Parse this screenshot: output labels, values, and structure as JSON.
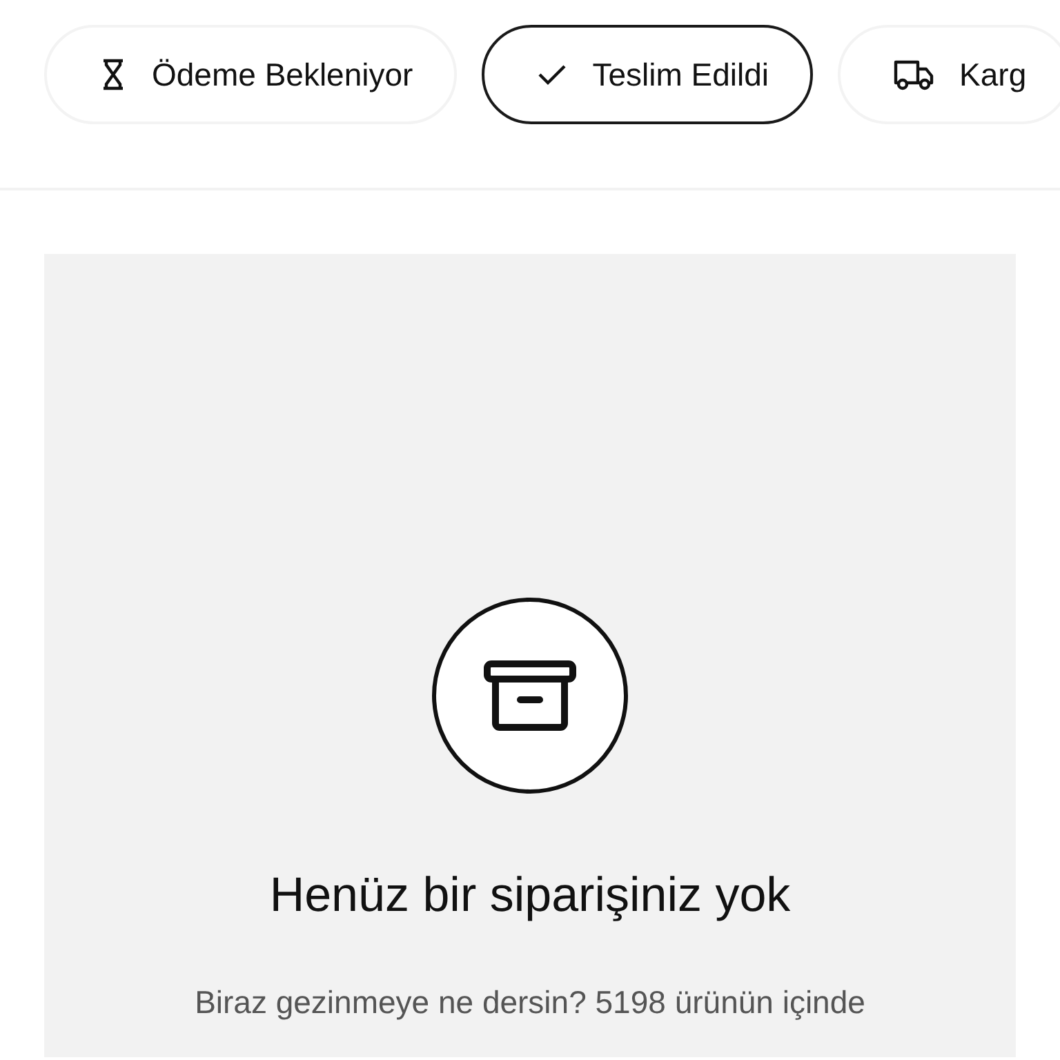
{
  "filters": [
    {
      "label": "Ödeme Bekleniyor",
      "kind": "hourglass",
      "selected": false
    },
    {
      "label": "Teslim Edildi",
      "kind": "check",
      "selected": true
    },
    {
      "label": "Karg",
      "kind": "truck",
      "selected": false
    }
  ],
  "empty_state": {
    "title": "Henüz bir siparişiniz yok",
    "message": "Biraz gezinmeye ne dersin? 5198 ürünün içinde"
  }
}
